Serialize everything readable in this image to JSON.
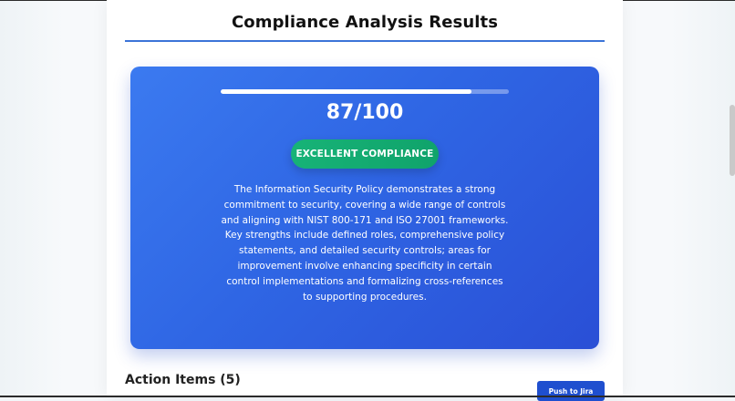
{
  "page": {
    "title": "Compliance Analysis Results"
  },
  "score_panel": {
    "progress_fraction": 0.87,
    "score_text": "87/100",
    "status_label": "EXCELLENT COMPLIANCE",
    "summary": "The Information Security Policy demonstrates a strong commitment to security, covering a wide range of controls and aligning with NIST 800-171 and ISO 27001 frameworks. Key strengths include defined roles, comprehensive policy statements, and detailed security controls; areas for improvement involve enhancing specificity in certain control implementations and formalizing cross-references to supporting procedures."
  },
  "action_items": {
    "heading": "Action Items (5)",
    "push_label": "Push to Jira"
  },
  "colors": {
    "accent": "#3b74d8",
    "panel_blue": "#2f66e4",
    "badge_green": "#10a36b",
    "button_blue": "#1f4fcf"
  }
}
